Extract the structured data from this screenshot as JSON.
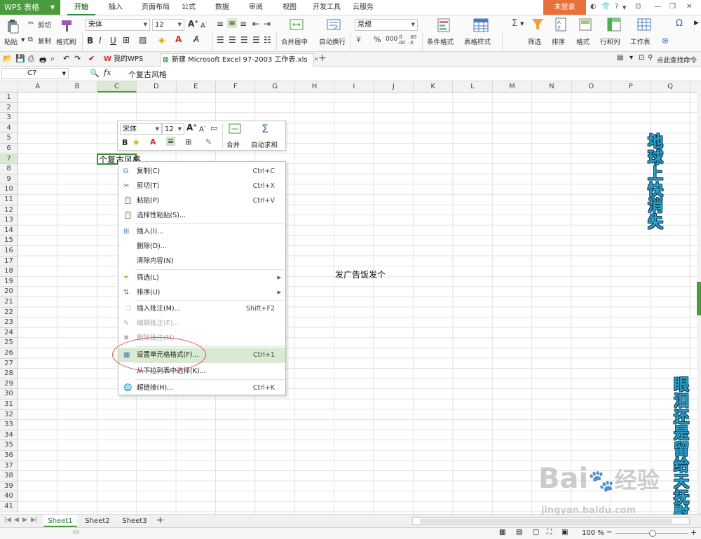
{
  "app": {
    "name": "WPS 表格",
    "login_label": "未登录"
  },
  "menu": {
    "tabs": [
      "开始",
      "插入",
      "页面布局",
      "公式",
      "数据",
      "审阅",
      "视图",
      "开发工具",
      "云服务"
    ],
    "active": "开始"
  },
  "ribbon": {
    "paste": "粘贴",
    "cut": "剪切",
    "copy": "复制",
    "format_painter": "格式刷",
    "font_name": "宋体",
    "font_size": "12",
    "merge_center": "合并居中",
    "wrap_text": "自动换行",
    "number_format": "常规",
    "conditional_format": "条件格式",
    "table_style": "表格样式",
    "filter": "筛选",
    "sort": "排序",
    "format": "格式",
    "rows_cols": "行和列",
    "worksheet": "工作表"
  },
  "quickbar": {
    "tabs": [
      {
        "label": "我的WPS"
      },
      {
        "label": "新建 Microsoft Excel 97-2003 工作表.xls"
      }
    ],
    "search_label": "点此查找命令"
  },
  "formula_bar": {
    "name_box": "C7",
    "fx": "fx",
    "content": "个复古风格"
  },
  "grid": {
    "columns": [
      "A",
      "B",
      "C",
      "D",
      "E",
      "F",
      "G",
      "H",
      "I",
      "J",
      "K",
      "L",
      "M",
      "N",
      "O",
      "P",
      "Q"
    ],
    "selected_column": "C",
    "selected_row": "7",
    "rows": [
      "1",
      "2",
      "3",
      "4",
      "5",
      "6",
      "7",
      "8",
      "9",
      "10",
      "11",
      "12",
      "13",
      "14",
      "15",
      "16",
      "17",
      "18",
      "19",
      "20",
      "21",
      "22",
      "23",
      "24",
      "25",
      "26",
      "27",
      "28",
      "29",
      "30",
      "31",
      "32",
      "33",
      "34",
      "35",
      "36",
      "37",
      "38",
      "39",
      "40",
      "41"
    ],
    "cell_c7": "个复古风格",
    "cell_i18": "发广告饭发个"
  },
  "decor": {
    "vertical_1": "地球上快消失",
    "vertical_2": "眼泪还是留给天抚慰"
  },
  "mini_toolbar": {
    "font_name": "宋体",
    "font_size": "12",
    "merge": "合并",
    "autosum": "自动求和"
  },
  "context_menu": {
    "items": [
      {
        "label": "复制(C)",
        "shortcut": "Ctrl+C",
        "icon": "copy-icon"
      },
      {
        "label": "剪切(T)",
        "shortcut": "Ctrl+X",
        "icon": "scissors-icon"
      },
      {
        "label": "粘贴(P)",
        "shortcut": "Ctrl+V",
        "icon": "paste-icon"
      },
      {
        "label": "选择性粘贴(S)...",
        "shortcut": "",
        "icon": "paste-special-icon"
      },
      {
        "label": "插入(I)...",
        "shortcut": "",
        "icon": "insert-cells-icon"
      },
      {
        "label": "删除(D)...",
        "shortcut": "",
        "icon": ""
      },
      {
        "label": "清除内容(N)",
        "shortcut": "",
        "icon": ""
      },
      {
        "label": "筛选(L)",
        "shortcut": "",
        "icon": "filter-icon"
      },
      {
        "label": "排序(U)",
        "shortcut": "",
        "icon": "sort-icon"
      },
      {
        "label": "插入批注(M)...",
        "shortcut": "Shift+F2",
        "icon": "comment-icon"
      },
      {
        "label": "编辑批注(E)...",
        "shortcut": "",
        "icon": "edit-comment-icon"
      },
      {
        "label": "删除批注(M)",
        "shortcut": "",
        "icon": "delete-comment-icon"
      },
      {
        "label": "设置单元格格式(F)...",
        "shortcut": "Ctrl+1",
        "icon": "format-cells-icon"
      },
      {
        "label": "从下拉列表中选择(K)...",
        "shortcut": "",
        "icon": ""
      },
      {
        "label": "超链接(H)...",
        "shortcut": "Ctrl+K",
        "icon": "hyperlink-icon"
      }
    ]
  },
  "sheets": {
    "tabs": [
      "Sheet1",
      "Sheet2",
      "Sheet3"
    ],
    "active": "Sheet1"
  },
  "status": {
    "zoom": "100 %"
  },
  "watermark": {
    "brand": "Bai",
    "brand2": "经验",
    "url": "jingyan.baidu.com"
  },
  "colors": {
    "accent": "#4a9b3c",
    "login": "#e8703c",
    "highlight": "#d8ead2",
    "annotation_circle": "#d9534f"
  }
}
